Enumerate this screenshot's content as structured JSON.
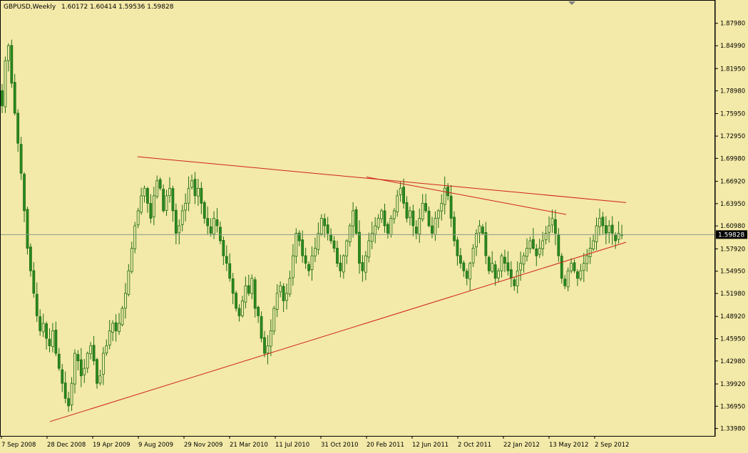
{
  "header": {
    "symbol": "GBPUSD,Weekly",
    "ohlc": "1.60172 1.60414 1.59536 1.59828"
  },
  "current_price_label": "1.59828",
  "colors": {
    "background": "#f3e9a8",
    "bull": "#2a8a1e",
    "bear": "#2a8a1e",
    "wick": "#1f6f14",
    "trendline": "#d0221b",
    "price_line": "#8a9a8e",
    "axis": "#000000"
  },
  "chart_data": {
    "type": "candlestick",
    "title": "",
    "xlabel": "",
    "ylabel": "",
    "ylim": [
      1.3328,
      1.8938
    ],
    "y_ticks": [
      "1.87980",
      "1.84990",
      "1.81950",
      "1.78980",
      "1.75950",
      "1.72950",
      "1.69980",
      "1.66920",
      "1.63950",
      "1.60980",
      "1.57920",
      "1.54950",
      "1.51980",
      "1.48920",
      "1.45950",
      "1.42980",
      "1.39920",
      "1.36950",
      "1.33980"
    ],
    "x_ticks": [
      "7 Sep 2008",
      "28 Dec 2008",
      "19 Apr 2009",
      "9 Aug 2009",
      "29 Nov 2009",
      "21 Mar 2010",
      "11 Jul 2010",
      "31 Oct 2010",
      "20 Feb 2011",
      "12 Jun 2011",
      "2 Oct 2011",
      "22 Jan 2012",
      "13 May 2012",
      "2 Sep 2012"
    ],
    "current_price": 1.59828,
    "close_series": [
      1.77,
      1.83,
      1.85,
      1.8,
      1.76,
      1.72,
      1.68,
      1.63,
      1.58,
      1.55,
      1.52,
      1.49,
      1.47,
      1.48,
      1.46,
      1.45,
      1.47,
      1.44,
      1.42,
      1.4,
      1.38,
      1.37,
      1.4,
      1.44,
      1.43,
      1.41,
      1.42,
      1.44,
      1.45,
      1.43,
      1.4,
      1.41,
      1.44,
      1.45,
      1.47,
      1.48,
      1.47,
      1.48,
      1.5,
      1.52,
      1.55,
      1.58,
      1.61,
      1.63,
      1.65,
      1.66,
      1.64,
      1.62,
      1.65,
      1.67,
      1.66,
      1.63,
      1.65,
      1.66,
      1.63,
      1.6,
      1.61,
      1.63,
      1.64,
      1.66,
      1.67,
      1.65,
      1.66,
      1.64,
      1.62,
      1.61,
      1.6,
      1.62,
      1.61,
      1.59,
      1.57,
      1.56,
      1.54,
      1.52,
      1.5,
      1.49,
      1.51,
      1.53,
      1.52,
      1.54,
      1.5,
      1.49,
      1.46,
      1.44,
      1.45,
      1.47,
      1.5,
      1.52,
      1.53,
      1.51,
      1.52,
      1.54,
      1.57,
      1.6,
      1.59,
      1.57,
      1.56,
      1.55,
      1.57,
      1.58,
      1.6,
      1.62,
      1.61,
      1.6,
      1.59,
      1.58,
      1.56,
      1.55,
      1.57,
      1.59,
      1.61,
      1.63,
      1.6,
      1.56,
      1.55,
      1.57,
      1.59,
      1.6,
      1.61,
      1.62,
      1.63,
      1.61,
      1.6,
      1.62,
      1.63,
      1.65,
      1.66,
      1.64,
      1.62,
      1.63,
      1.61,
      1.6,
      1.62,
      1.64,
      1.63,
      1.61,
      1.6,
      1.62,
      1.63,
      1.64,
      1.66,
      1.65,
      1.62,
      1.59,
      1.57,
      1.56,
      1.55,
      1.54,
      1.56,
      1.58,
      1.6,
      1.61,
      1.6,
      1.57,
      1.55,
      1.56,
      1.54,
      1.55,
      1.57,
      1.56,
      1.55,
      1.54,
      1.53,
      1.55,
      1.56,
      1.57,
      1.58,
      1.59,
      1.58,
      1.57,
      1.58,
      1.59,
      1.6,
      1.61,
      1.62,
      1.6,
      1.57,
      1.54,
      1.53,
      1.55,
      1.56,
      1.55,
      1.54,
      1.55,
      1.56,
      1.57,
      1.58,
      1.59,
      1.61,
      1.62,
      1.61,
      1.6,
      1.61,
      1.6,
      1.59,
      1.6,
      1.598
    ],
    "trendlines": [
      {
        "name": "upper-resistance",
        "from": {
          "x": "7 Aug 2009",
          "y": 1.702
        },
        "to": {
          "x": "18 Nov 2012",
          "y": 1.641
        }
      },
      {
        "name": "lower-support",
        "from": {
          "x": "4 Jan 2009",
          "y": 1.349
        },
        "to": {
          "x": "18 Nov 2012",
          "y": 1.588
        }
      },
      {
        "name": "secondary-resistance",
        "from": {
          "x": "20 Feb 2011",
          "y": 1.675
        },
        "to": {
          "x": "24 Jun 2012",
          "y": 1.625
        }
      }
    ]
  }
}
